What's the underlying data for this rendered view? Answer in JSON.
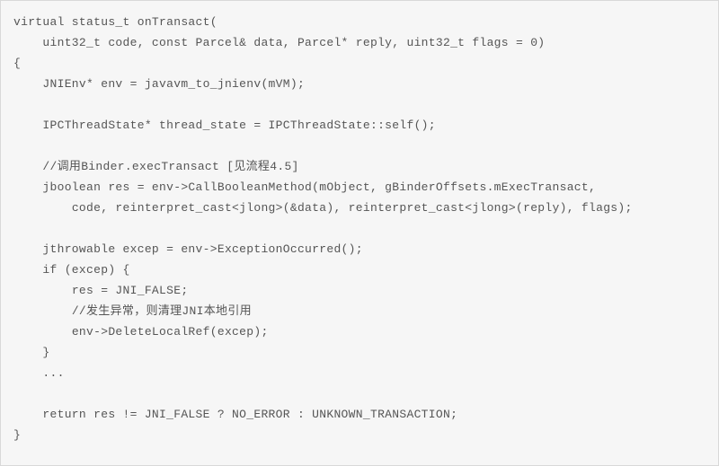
{
  "code": {
    "lines": [
      "virtual status_t onTransact(",
      "    uint32_t code, const Parcel& data, Parcel* reply, uint32_t flags = 0)",
      "{",
      "    JNIEnv* env = javavm_to_jnienv(mVM);",
      "",
      "    IPCThreadState* thread_state = IPCThreadState::self();",
      "",
      "    //调用Binder.execTransact [见流程4.5]",
      "    jboolean res = env->CallBooleanMethod(mObject, gBinderOffsets.mExecTransact,",
      "        code, reinterpret_cast<jlong>(&data), reinterpret_cast<jlong>(reply), flags);",
      "",
      "    jthrowable excep = env->ExceptionOccurred();",
      "    if (excep) {",
      "        res = JNI_FALSE;",
      "        //发生异常，则清理JNI本地引用",
      "        env->DeleteLocalRef(excep);",
      "    }",
      "    ...",
      "",
      "    return res != JNI_FALSE ? NO_ERROR : UNKNOWN_TRANSACTION;",
      "}"
    ]
  }
}
